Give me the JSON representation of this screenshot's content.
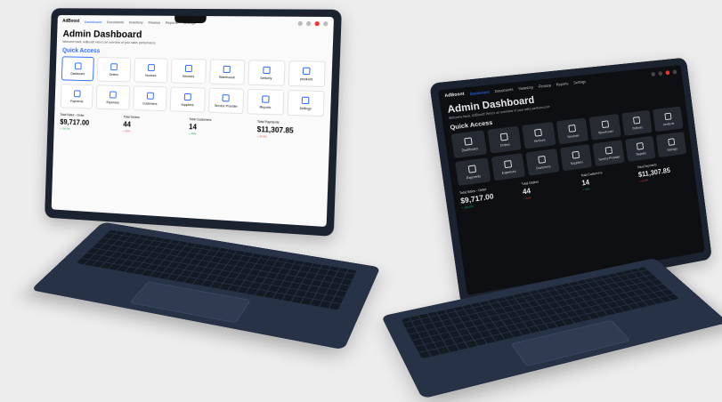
{
  "laptops": [
    {
      "theme": "light",
      "logo": "AdBoost",
      "nav": [
        "Dashboard",
        "Documents",
        "Inventory",
        "Finance",
        "Reports",
        "Settings"
      ],
      "title": "Admin Dashboard",
      "subtitle": "Welcome back, AdBoost! Here's an overview of your sales performance",
      "quick_access_label": "Quick Access",
      "tiles": [
        "Dashboard",
        "Orders",
        "Invoices",
        "Services",
        "Warehouse",
        "Delivery",
        "products",
        "Payments",
        "Expenses",
        "Customers",
        "Suppliers",
        "Service Provider",
        "Reports",
        "Settings"
      ],
      "stats": [
        {
          "label": "Total Sales - Order",
          "value": "$9,717.00",
          "change": "+ 100.0%",
          "dir": "up"
        },
        {
          "label": "Total Orders",
          "value": "44",
          "change": "+ 12%",
          "dir": "down"
        },
        {
          "label": "Total Customers",
          "value": "14",
          "change": "+ 48%",
          "dir": "up"
        },
        {
          "label": "Total Payments",
          "value": "$11,307.85",
          "change": "+ 10.2%",
          "dir": "down"
        }
      ]
    },
    {
      "theme": "dark",
      "logo": "AdBoost",
      "nav": [
        "Dashboard",
        "Documents",
        "Inventory",
        "Finance",
        "Reports",
        "Settings"
      ],
      "title": "Admin Dashboard",
      "subtitle": "Welcome back, AdBoost! Here's an overview of your sales performance",
      "quick_access_label": "Quick Access",
      "tiles": [
        "Dashboard",
        "Orders",
        "Invoices",
        "Services",
        "Warehouse",
        "Delivery",
        "products",
        "Payments",
        "Expenses",
        "Customers",
        "Suppliers",
        "Service Provider",
        "Reports",
        "Settings"
      ],
      "stats": [
        {
          "label": "Total Sales - Order",
          "value": "$9,717.00",
          "change": "+ 100.0%",
          "dir": "up"
        },
        {
          "label": "Total Orders",
          "value": "44",
          "change": "+ 12%",
          "dir": "down"
        },
        {
          "label": "Total Customers",
          "value": "14",
          "change": "+ 48%",
          "dir": "up"
        },
        {
          "label": "Total Payments",
          "value": "$11,307.85",
          "change": "+ 10.2%",
          "dir": "down"
        }
      ]
    }
  ],
  "colors": {
    "background": "#ededed",
    "accent": "#2f6bff",
    "body": "#273246"
  }
}
